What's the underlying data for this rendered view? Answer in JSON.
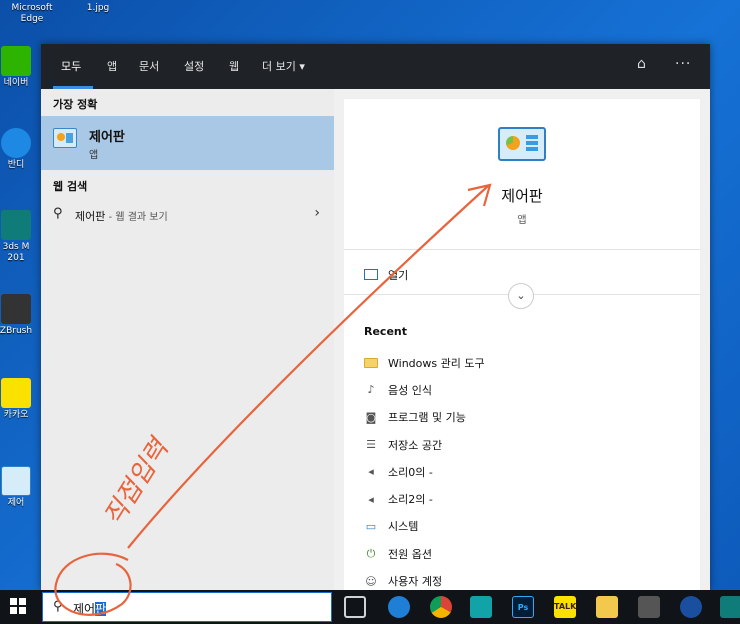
{
  "desktop": {
    "icons": [
      {
        "label": "Microsoft\nEdge"
      },
      {
        "label": "1.jpg"
      },
      {
        "label": "네이버"
      },
      {
        "label": "반디"
      },
      {
        "label": "3ds M\n201"
      },
      {
        "label": "ZBrush"
      },
      {
        "label": "카카오"
      },
      {
        "label": "제어"
      }
    ]
  },
  "search_panel": {
    "tabs": [
      {
        "label": "모두"
      },
      {
        "label": "앱"
      },
      {
        "label": "문서"
      },
      {
        "label": "설정"
      },
      {
        "label": "웹"
      },
      {
        "label": "더 보기 ▾"
      }
    ],
    "feedback_icon": "feedback-icon",
    "more_icon": "more-options-icon",
    "best_match": {
      "heading": "가장 정확",
      "title": "제어판",
      "subtitle": "앱"
    },
    "web_search": {
      "heading": "웹 검색",
      "query": "제어판",
      "suffix": " - 웹 결과 보기"
    },
    "detail": {
      "title": "제어판",
      "subtitle": "앱",
      "open_label": "열기",
      "recent_heading": "Recent",
      "recent": [
        {
          "label": "Windows 관리 도구",
          "icon": "folder-icon"
        },
        {
          "label": "음성 인식",
          "icon": "microphone-icon"
        },
        {
          "label": "프로그램 및 기능",
          "icon": "programs-icon"
        },
        {
          "label": "저장소 공간",
          "icon": "storage-icon"
        },
        {
          "label": "소리0의 -",
          "icon": "speaker-icon"
        },
        {
          "label": "소리2의 -",
          "icon": "speaker-icon"
        },
        {
          "label": "시스템",
          "icon": "monitor-icon"
        },
        {
          "label": "전원 옵션",
          "icon": "power-icon"
        },
        {
          "label": "사용자 계정",
          "icon": "users-icon"
        }
      ]
    }
  },
  "taskbar": {
    "search_value_plain": "제어",
    "search_value_selected": "판",
    "photoshop_label": "Ps",
    "kakao_label": "TALK"
  },
  "annotation": {
    "handwritten": "직접입력"
  },
  "colors": {
    "panel_tabbar": "#1f2226",
    "accent": "#3a8ee6",
    "best_match_highlight": "#a9c8e6",
    "annotation": "#e8643c"
  }
}
